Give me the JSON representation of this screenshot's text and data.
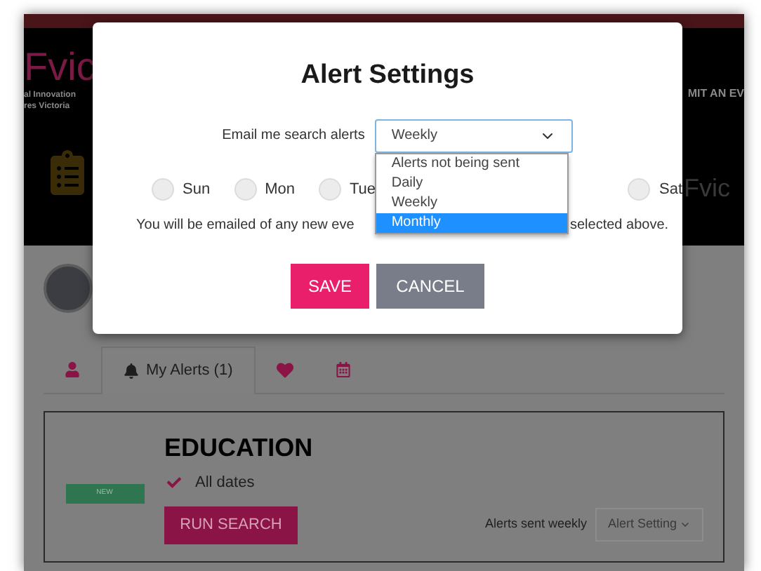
{
  "header": {
    "logo": "Fvic",
    "tagline_lines": [
      "al Innovation",
      "res Victoria"
    ],
    "nav_link": "MIT AN EV",
    "banner_text": "Fvic"
  },
  "tabs": [
    {
      "kind": "user",
      "selected": false
    },
    {
      "kind": "alerts",
      "label": "My Alerts (1)",
      "selected": true
    },
    {
      "kind": "heart",
      "selected": false
    },
    {
      "kind": "calendar",
      "selected": false
    }
  ],
  "alert_card": {
    "badge": "NEW",
    "title": "EDUCATION",
    "criteria": [
      {
        "label": "All dates",
        "checked": true
      }
    ],
    "run_button": "RUN SEARCH",
    "frequency_text": "Alerts sent weekly",
    "settings_button": "Alert Setting"
  },
  "modal": {
    "title": "Alert Settings",
    "frequency_label": "Email me search alerts",
    "frequency_value": "Weekly",
    "frequency_options": [
      {
        "label": "Alerts not being sent",
        "selected": false
      },
      {
        "label": "Daily",
        "selected": false
      },
      {
        "label": "Weekly",
        "selected": false
      },
      {
        "label": "Monthly",
        "selected": true
      }
    ],
    "days": [
      {
        "label": "Sun",
        "selected": false
      },
      {
        "label": "Mon",
        "selected": false
      },
      {
        "label": "Tue",
        "selected": false
      },
      {
        "label": "Sat",
        "selected": false
      }
    ],
    "note_parts": [
      "You will be emailed of any new eve",
      "selected above."
    ],
    "buttons": [
      {
        "kind": "primary",
        "label": "SAVE"
      },
      {
        "kind": "secondary",
        "label": "CANCEL"
      }
    ]
  }
}
